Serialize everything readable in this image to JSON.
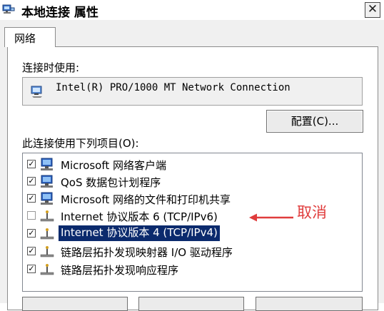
{
  "window": {
    "title": "本地连接 属性",
    "close_glyph": "✕"
  },
  "tabs": [
    {
      "label": "网络",
      "selected": true
    }
  ],
  "connect_using": {
    "label": "连接时使用:",
    "adapter": "Intel(R) PRO/1000 MT Network Connection",
    "configure_label": "配置(C)..."
  },
  "items_section": {
    "label": "此连接使用下列项目(O):",
    "items": [
      {
        "label": "Microsoft 网络客户端",
        "checked": true,
        "icon": "network-client-icon",
        "selected": false
      },
      {
        "label": "QoS 数据包计划程序",
        "checked": true,
        "icon": "qos-scheduler-icon",
        "selected": false
      },
      {
        "label": "Microsoft 网络的文件和打印机共享",
        "checked": true,
        "icon": "file-printer-sharing-icon",
        "selected": false
      },
      {
        "label": "Internet 协议版本 6 (TCP/IPv6)",
        "checked": false,
        "icon": "protocol-icon",
        "selected": false
      },
      {
        "label": "Internet 协议版本 4 (TCP/IPv4)",
        "checked": true,
        "icon": "protocol-icon",
        "selected": true
      },
      {
        "label": "链路层拓扑发现映射器 I/O 驱动程序",
        "checked": true,
        "icon": "protocol-icon",
        "selected": false
      },
      {
        "label": "链路层拓扑发现响应程序",
        "checked": true,
        "icon": "protocol-icon",
        "selected": false
      }
    ]
  },
  "annotation": {
    "text": "取消",
    "color": "#e03c3c"
  },
  "colors": {
    "selection": "#0b2a6d",
    "dialog_bg": "#f0f0f0"
  }
}
